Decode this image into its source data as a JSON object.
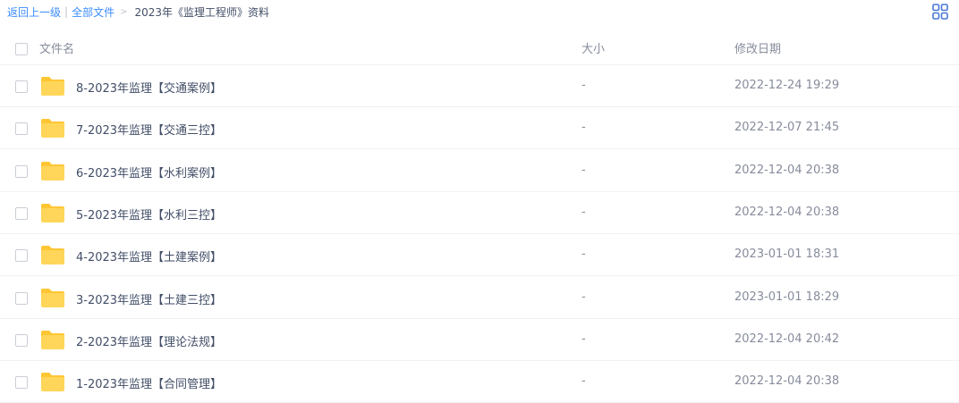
{
  "breadcrumb": {
    "back_label": "返回上一级",
    "separator": "|",
    "all_files_label": "全部文件",
    "arrow": ">",
    "current": "2023年《监理工程师》资料"
  },
  "table": {
    "headers": {
      "name": "文件名",
      "size": "大小",
      "date": "修改日期"
    },
    "rows": [
      {
        "name": "8-2023年监理【交通案例】",
        "size": "-",
        "date": "2022-12-24 19:29"
      },
      {
        "name": "7-2023年监理【交通三控】",
        "size": "-",
        "date": "2022-12-07 21:45"
      },
      {
        "name": "6-2023年监理【水利案例】",
        "size": "-",
        "date": "2022-12-04 20:38"
      },
      {
        "name": "5-2023年监理【水利三控】",
        "size": "-",
        "date": "2022-12-04 20:38"
      },
      {
        "name": "4-2023年监理【土建案例】",
        "size": "-",
        "date": "2023-01-01 18:31"
      },
      {
        "name": "3-2023年监理【土建三控】",
        "size": "-",
        "date": "2023-01-01 18:29"
      },
      {
        "name": "2-2023年监理【理论法规】",
        "size": "-",
        "date": "2022-12-04 20:42"
      },
      {
        "name": "1-2023年监理【合同管理】",
        "size": "-",
        "date": "2022-12-04 20:38"
      }
    ]
  },
  "icons": {
    "folder": "folder-icon",
    "view_toggle": "grid-view-icon"
  },
  "colors": {
    "link": "#3b8cff",
    "folder": "#ffd659",
    "folder_back": "#ffc634",
    "text": "#424e67",
    "muted": "#878c9c"
  }
}
